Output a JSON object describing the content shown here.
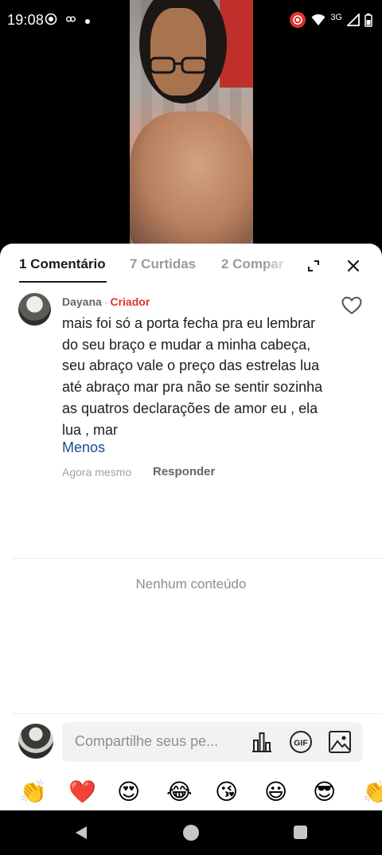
{
  "status_bar": {
    "time": "19:08",
    "network": "3G",
    "left_icons": [
      "record-icon",
      "link-icon",
      "dot-icon"
    ],
    "right_icons": [
      "screen-record-icon",
      "wifi-icon",
      "signal-icon",
      "battery-icon"
    ]
  },
  "tabs": [
    {
      "label": "1 Comentário",
      "active": true
    },
    {
      "label": "7 Curtidas",
      "active": false
    },
    {
      "label": "2 Compar",
      "active": false
    }
  ],
  "header_icons": [
    "expand-icon",
    "close-icon"
  ],
  "comment": {
    "author": "Dayana",
    "separator": "·",
    "badge": "Criador",
    "text": "mais foi só a porta fecha pra eu lembrar do seu braço e mudar a minha cabeça, seu abraço vale o preço das estrelas lua até abraço mar pra não se sentir sozinha as quatros declarações de amor eu , ela lua , mar",
    "less_label": "Menos",
    "time": "Agora mesmo",
    "reply_label": "Responder"
  },
  "empty_state": "Nenhum conteúdo",
  "composer": {
    "placeholder": "Compartilhe seus pe...",
    "icons": [
      "poll-icon",
      "gif-icon",
      "image-icon"
    ]
  },
  "emojis": [
    "👏",
    "❤️",
    "😍",
    "😂",
    "😘",
    "😃",
    "😎",
    "👏"
  ],
  "colors": {
    "accent_red": "#e0322d",
    "link_blue": "#1d4c8c",
    "text_dark": "#1e1e1e",
    "muted": "#9b9b9b"
  }
}
